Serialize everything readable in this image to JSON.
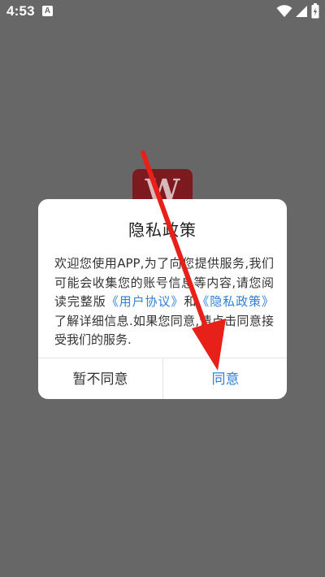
{
  "status_bar": {
    "time": "4:53",
    "notification_icon": "a-box-icon",
    "notification_glyph": "A",
    "icons": [
      "wifi-icon",
      "cell-signal-icon",
      "battery-icon"
    ]
  },
  "app_logo": {
    "letter": "W",
    "color": "#7d1a1f"
  },
  "dialog": {
    "title": "隐私政策",
    "body_text_1": "欢迎您使用APP,为了向您提供服务,我们可能会收集您的账号信息等内容,请您阅读完整版",
    "link_user_agreement": "《用户协议》",
    "body_and": "和",
    "link_privacy_policy": "《隐私政策》",
    "body_text_2": "了解详细信息.如果您同意,请点击同意接受我们的服务.",
    "decline_button": "暂不同意",
    "agree_button": "同意"
  },
  "colors": {
    "overlay": "#676767",
    "link": "#2f7fd6",
    "annotation_arrow": "#e8201a"
  }
}
